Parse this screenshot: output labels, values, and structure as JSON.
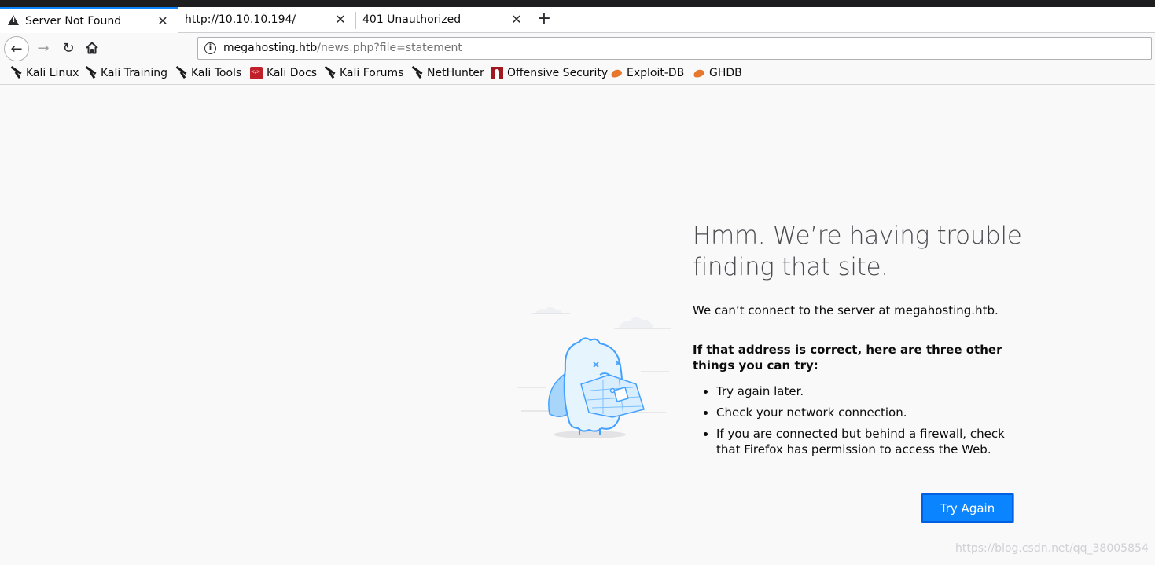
{
  "tabs": [
    {
      "label": "Server Not Found",
      "active": true,
      "icon": "warning-icon"
    },
    {
      "label": "http://10.10.10.194/",
      "active": false
    },
    {
      "label": "401 Unauthorized",
      "active": false
    }
  ],
  "tab_close_glyph": "✕",
  "new_tab_glyph": "+",
  "nav": {
    "back_glyph": "←",
    "forward_glyph": "→",
    "reload_glyph": "↻",
    "home_icon": "home-icon"
  },
  "url": {
    "host": "megahosting.htb",
    "path": "/news.php?file=statement",
    "info_glyph": "i"
  },
  "bookmarks": [
    {
      "label": "Kali Linux",
      "icon": "kali-icon"
    },
    {
      "label": "Kali Training",
      "icon": "kali-icon"
    },
    {
      "label": "Kali Tools",
      "icon": "kali-icon"
    },
    {
      "label": "Kali Docs",
      "icon": "kali-docs-icon"
    },
    {
      "label": "Kali Forums",
      "icon": "kali-icon"
    },
    {
      "label": "NetHunter",
      "icon": "kali-icon"
    },
    {
      "label": "Offensive Security",
      "icon": "offsec-icon"
    },
    {
      "label": "Exploit-DB",
      "icon": "exploit-db-icon"
    },
    {
      "label": "GHDB",
      "icon": "exploit-db-icon"
    }
  ],
  "error": {
    "title": "Hmm. We’re having trouble finding that site.",
    "lead": "We can’t connect to the server at megahosting.htb.",
    "subhead": "If that address is correct, here are three other things you can try:",
    "tips": [
      "Try again later.",
      "Check your network connection.",
      "If you are connected but behind a firewall, check that Firefox has permission to access the Web."
    ],
    "button_label": "Try Again"
  },
  "watermark": "https://blog.csdn.net/qq_38005854",
  "colors": {
    "accent": "#0a84ff",
    "title": "#4a4a4f",
    "illustration": "#45a1ff"
  }
}
